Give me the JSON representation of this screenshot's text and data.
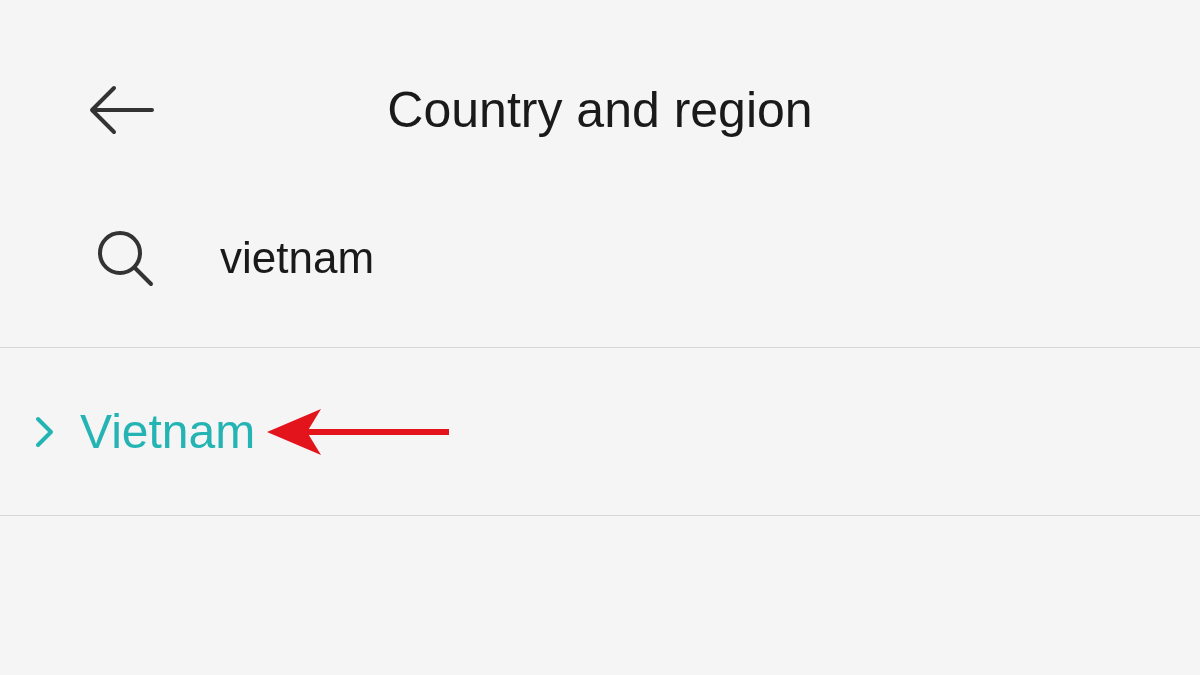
{
  "header": {
    "title": "Country and region"
  },
  "search": {
    "value": "vietnam"
  },
  "results": [
    {
      "label": "Vietnam",
      "selected": true
    }
  ]
}
